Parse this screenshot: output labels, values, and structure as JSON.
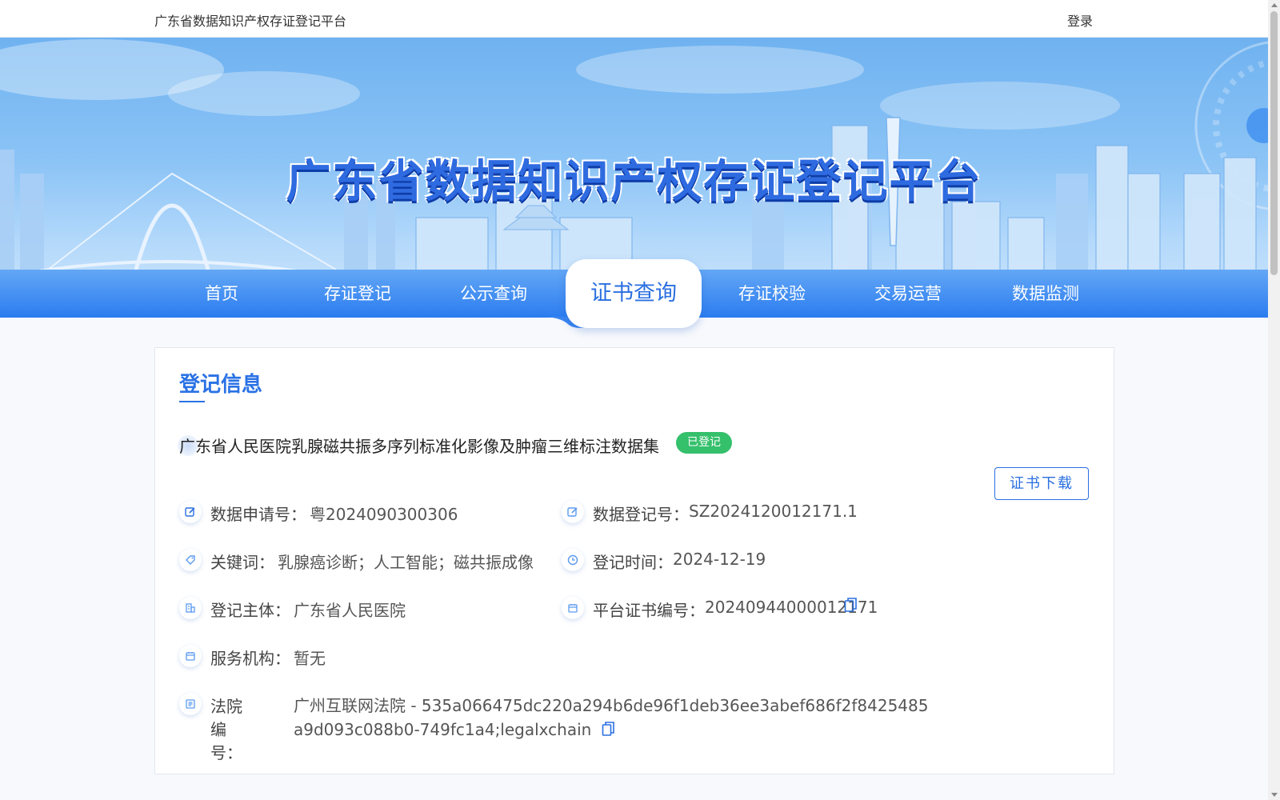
{
  "topbar": {
    "site_name": "广东省数据知识产权存证登记平台",
    "login": "登录"
  },
  "banner": {
    "title": "广东省数据知识产权存证登记平台"
  },
  "nav": {
    "items": [
      "首页",
      "存证登记",
      "公示查询",
      "证书查询",
      "存证校验",
      "交易运营",
      "数据监测"
    ],
    "active": "证书查询"
  },
  "card": {
    "section_title": "登记信息",
    "dataset_title": "广东省人民医院乳腺磁共振多序列标准化影像及肿瘤三维标注数据集",
    "status": "已登记",
    "download": "证书下载",
    "fields": {
      "apply_no": {
        "label": "数据申请号：",
        "value": "粤2024090300306",
        "icon": "edit-icon"
      },
      "reg_no": {
        "label": "数据登记号：",
        "value": "SZ2024120012171.1",
        "icon": "edit-icon"
      },
      "keywords": {
        "label": "关键词：",
        "value": "乳腺癌诊断；人工智能；磁共振成像",
        "icon": "tag-icon"
      },
      "reg_time": {
        "label": "登记时间：",
        "value": "2024-12-19",
        "icon": "clock-icon"
      },
      "subject": {
        "label": "登记主体：",
        "value": "广东省人民医院",
        "icon": "building-icon"
      },
      "cert_no": {
        "label": "平台证书编号：",
        "value": "20240944000012171",
        "icon": "calendar-icon"
      },
      "service": {
        "label": "服务机构：",
        "value": "暂无",
        "icon": "calendar-icon"
      },
      "court": {
        "label": "法院编号：",
        "value": "广州互联网法院 - 535a066475dc220a294b6de96f1deb36ee3abef686f2f8425485a9d093c088b0-749fc1a4;legalxchain",
        "icon": "list-icon"
      }
    }
  },
  "colors": {
    "primary": "#2a6fe0",
    "status_green": "#35c06c",
    "nav_top": "#63a7f5",
    "nav_bottom": "#2b7cf0"
  }
}
